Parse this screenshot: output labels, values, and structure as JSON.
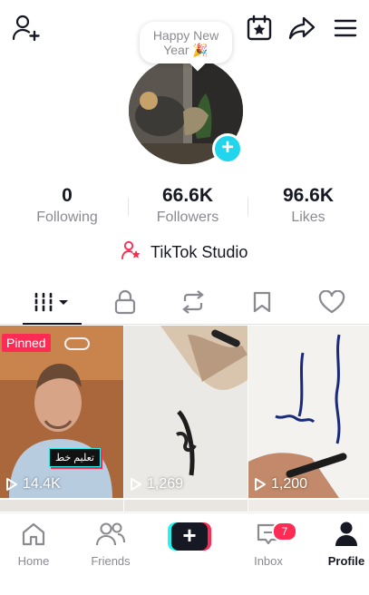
{
  "header": {
    "add_friend_icon": "person-plus-icon",
    "calendar_icon": "calendar-star-icon",
    "share_icon": "share-arrow-icon",
    "menu_icon": "hamburger-menu-icon"
  },
  "profile": {
    "greeting": "Happy New Year 🎉",
    "add_badge": "+"
  },
  "stats": [
    {
      "value": "0",
      "label": "Following"
    },
    {
      "value": "66.6K",
      "label": "Followers"
    },
    {
      "value": "96.6K",
      "label": "Likes"
    }
  ],
  "studio": {
    "label": "TikTok Studio",
    "icon": "person-star-icon"
  },
  "tabs": [
    {
      "icon": "grid-videos-icon"
    },
    {
      "icon": "lock-icon"
    },
    {
      "icon": "repost-icon"
    },
    {
      "icon": "bookmark-icon"
    },
    {
      "icon": "heart-icon"
    }
  ],
  "videos": [
    {
      "views": "14.4K",
      "pinned": "Pinned",
      "caption": "تعليم خط"
    },
    {
      "views": "1,269"
    },
    {
      "views": "1,200"
    }
  ],
  "nav": [
    {
      "label": "Home"
    },
    {
      "label": "Friends"
    },
    {
      "label": "+"
    },
    {
      "label": "Inbox",
      "badge": "7"
    },
    {
      "label": "Profile"
    }
  ],
  "colors": {
    "accent_red": "#fe2c55",
    "accent_cyan": "#25f4ee",
    "text_dark": "#161823",
    "text_gray": "#8a8b91"
  }
}
